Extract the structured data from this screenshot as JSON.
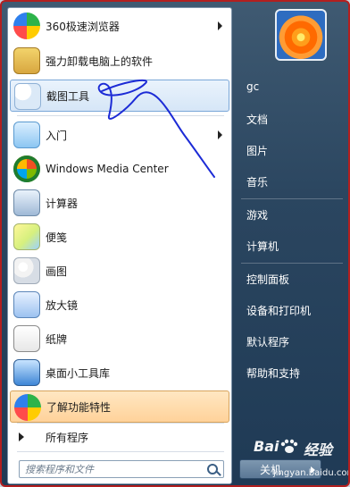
{
  "start_menu": {
    "left_items": [
      {
        "label": "360极速浏览器",
        "icon": "360-browser-icon",
        "has_submenu": true
      },
      {
        "label": "强力卸载电脑上的软件",
        "icon": "uninstall-box-icon",
        "has_submenu": false
      },
      {
        "label": "截图工具",
        "icon": "snipping-tool-icon",
        "has_submenu": false,
        "selected": true
      },
      {
        "label": "入门",
        "icon": "getting-started-icon",
        "has_submenu": true
      },
      {
        "label": "Windows Media Center",
        "icon": "windows-media-center-icon",
        "has_submenu": false
      },
      {
        "label": "计算器",
        "icon": "calculator-icon",
        "has_submenu": false
      },
      {
        "label": "便笺",
        "icon": "sticky-notes-icon",
        "has_submenu": false
      },
      {
        "label": "画图",
        "icon": "paint-icon",
        "has_submenu": false
      },
      {
        "label": "放大镜",
        "icon": "magnifier-icon",
        "has_submenu": false
      },
      {
        "label": "纸牌",
        "icon": "solitaire-icon",
        "has_submenu": false
      },
      {
        "label": "桌面小工具库",
        "icon": "desktop-gadgets-icon",
        "has_submenu": false
      },
      {
        "label": "了解功能特性",
        "icon": "360-features-icon",
        "has_submenu": false,
        "highlighted": true
      }
    ],
    "all_programs_label": "所有程序",
    "search_placeholder": "搜索程序和文件",
    "right_items": [
      "gc",
      "文档",
      "图片",
      "音乐",
      "游戏",
      "计算机",
      "控制面板",
      "设备和打印机",
      "默认程序",
      "帮助和支持"
    ],
    "shutdown_label": "关机",
    "watermark": {
      "brand": "Bai",
      "brand2": "经验",
      "url": "jingyan.baidu.com"
    }
  }
}
